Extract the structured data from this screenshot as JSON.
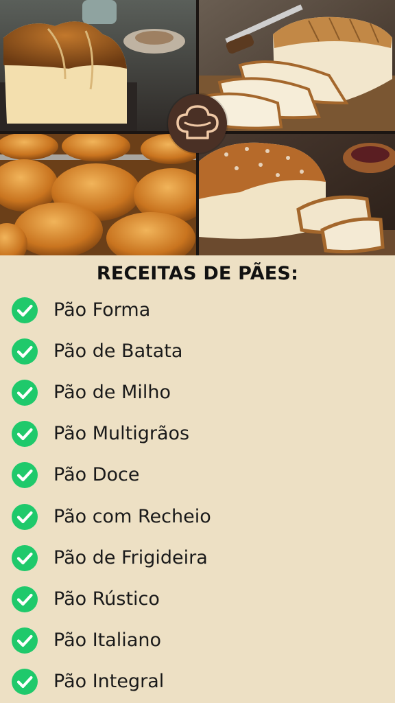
{
  "heading": "RECEITAS DE PÃES:",
  "images": [
    {
      "name": "brioche-loaf-photo"
    },
    {
      "name": "sliced-white-bread-photo"
    },
    {
      "name": "dinner-rolls-photo"
    },
    {
      "name": "sweet-braided-bread-photo"
    }
  ],
  "badge_icon": "chef-hat-icon",
  "check_icon": "check-circle-icon",
  "colors": {
    "background": "#ede0c4",
    "check": "#1fc96b",
    "badge": "#4a3025"
  },
  "recipes": [
    {
      "label": "Pão Forma"
    },
    {
      "label": "Pão de Batata"
    },
    {
      "label": "Pão de Milho"
    },
    {
      "label": "Pão Multigrãos"
    },
    {
      "label": "Pão Doce"
    },
    {
      "label": "Pão com Recheio"
    },
    {
      "label": "Pão de Frigideira"
    },
    {
      "label": "Pão Rústico"
    },
    {
      "label": "Pão Italiano"
    },
    {
      "label": "Pão Integral"
    }
  ]
}
